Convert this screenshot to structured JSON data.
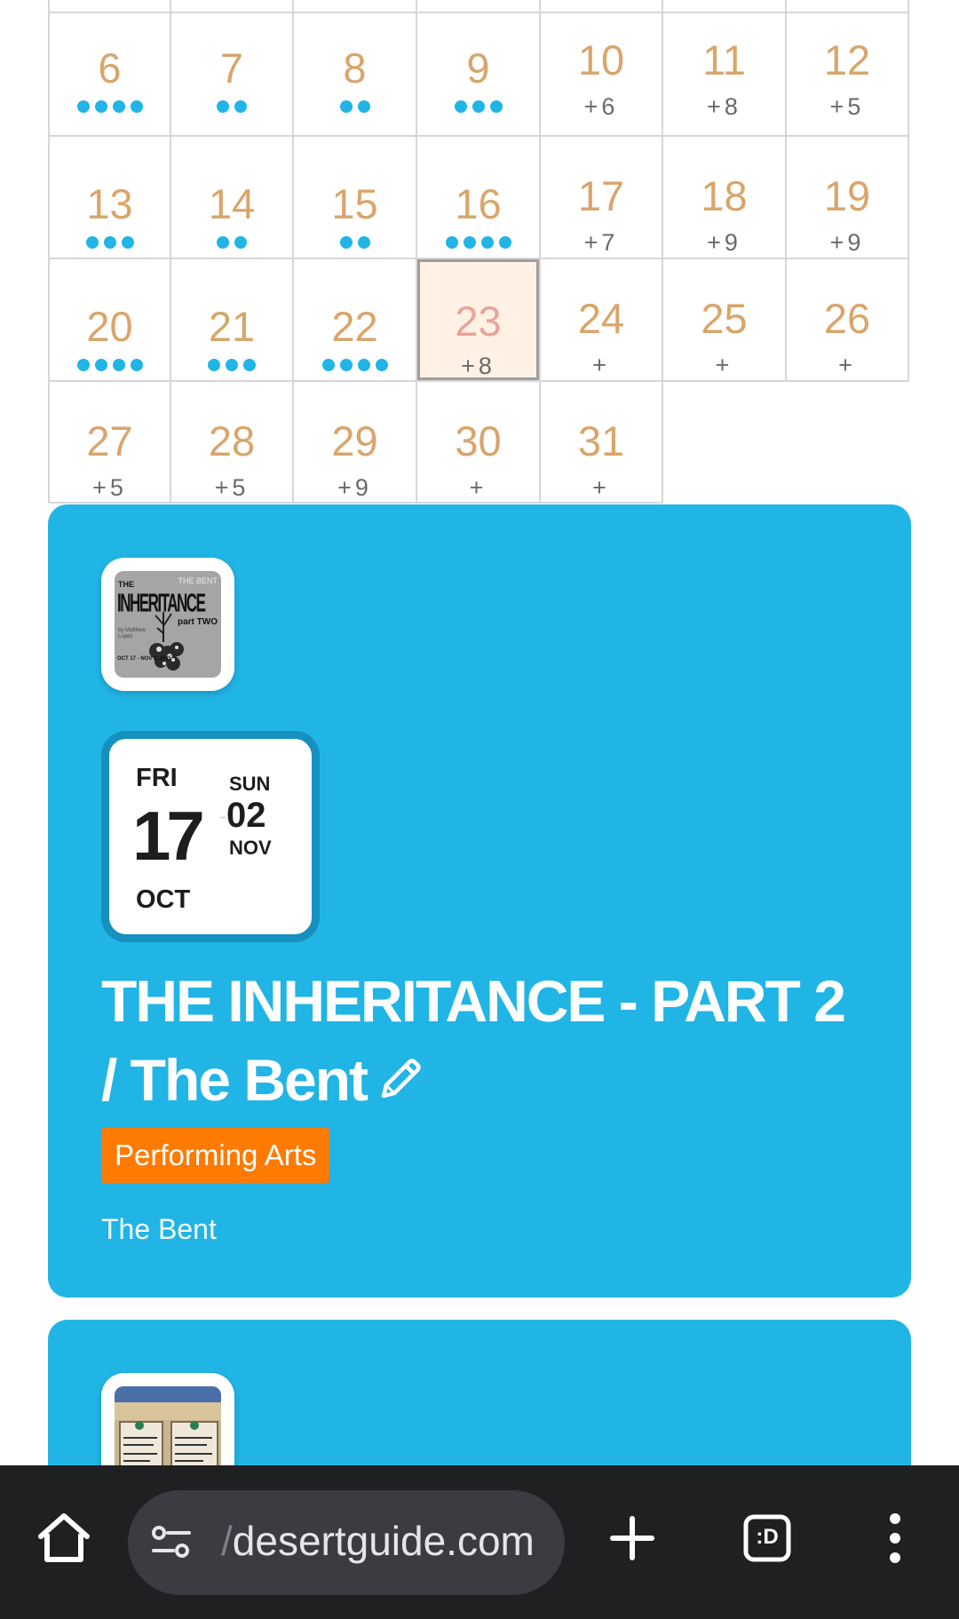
{
  "calendar": {
    "weeks": [
      [
        {
          "day": "6",
          "dots": 4
        },
        {
          "day": "7",
          "dots": 2
        },
        {
          "day": "8",
          "dots": 2
        },
        {
          "day": "9",
          "dots": 3
        },
        {
          "day": "10",
          "more": "+6"
        },
        {
          "day": "11",
          "more": "+8"
        },
        {
          "day": "12",
          "more": "+5"
        }
      ],
      [
        {
          "day": "13",
          "dots": 3
        },
        {
          "day": "14",
          "dots": 2
        },
        {
          "day": "15",
          "dots": 2
        },
        {
          "day": "16",
          "dots": 4
        },
        {
          "day": "17",
          "more": "+7"
        },
        {
          "day": "18",
          "more": "+9"
        },
        {
          "day": "19",
          "more": "+9"
        }
      ],
      [
        {
          "day": "20",
          "dots": 4
        },
        {
          "day": "21",
          "dots": 3
        },
        {
          "day": "22",
          "dots": 4
        },
        {
          "day": "23",
          "more": "+8",
          "today": true
        },
        {
          "day": "24",
          "more": "+"
        },
        {
          "day": "25",
          "more": "+"
        },
        {
          "day": "26",
          "more": "+"
        }
      ],
      [
        {
          "day": "27",
          "more": "+5"
        },
        {
          "day": "28",
          "more": "+5"
        },
        {
          "day": "29",
          "more": "+9"
        },
        {
          "day": "30",
          "more": "+"
        },
        {
          "day": "31",
          "more": "+"
        }
      ]
    ],
    "colors": {
      "day_number": "#d9a56b",
      "today_number": "#e8a49a",
      "dot": "#21b5e5",
      "today_bg": "#fff1e4"
    }
  },
  "events": [
    {
      "thumbnail": {
        "title_line1": "THE",
        "title_line2": "INHERITANCE",
        "subtitle": "part TWO",
        "badge": "THE BENT",
        "dates": "OCT 17 - NOV 2, 2025",
        "credit": "by Matthew Lopez"
      },
      "start": {
        "weekday": "FRI",
        "day": "17",
        "month": "OCT"
      },
      "separator": "-",
      "end": {
        "weekday": "SUN",
        "day": "02",
        "month": "NOV"
      },
      "title": "THE INHERITANCE - PART 2 / The Bent",
      "category": "Performing Arts",
      "venue": "The Bent",
      "colors": {
        "card": "#21b5e5",
        "category": "#ff7a00"
      }
    }
  ],
  "browser": {
    "url_prefix": "/",
    "url": "desertguide.com",
    "tab_icon_label": ":D",
    "icons": [
      "home-icon",
      "site-settings-icon",
      "new-tab-icon",
      "tab-switcher-icon",
      "more-menu-icon"
    ]
  }
}
